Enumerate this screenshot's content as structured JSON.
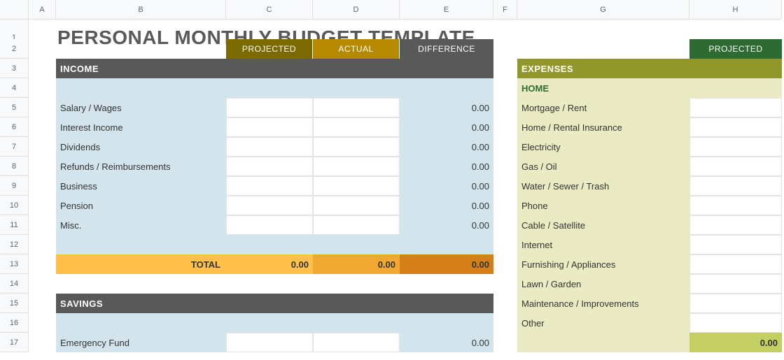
{
  "columns": [
    "A",
    "B",
    "C",
    "D",
    "E",
    "F",
    "G",
    "H"
  ],
  "rowNumbers": [
    "1",
    "2",
    "3",
    "4",
    "5",
    "6",
    "7",
    "8",
    "9",
    "10",
    "11",
    "12",
    "13",
    "14",
    "15",
    "16",
    "17"
  ],
  "title": "PERSONAL MONTHLY BUDGET TEMPLATE",
  "tabs": {
    "projected": "PROJECTED",
    "actual": "ACTUAL",
    "difference": "DIFFERENCE",
    "projected2": "PROJECTED"
  },
  "sections": {
    "income": "INCOME",
    "savings": "SAVINGS",
    "expenses": "EXPENSES",
    "home": "HOME"
  },
  "income": {
    "rows": [
      {
        "label": "Salary / Wages",
        "diff": "0.00"
      },
      {
        "label": "Interest Income",
        "diff": "0.00"
      },
      {
        "label": "Dividends",
        "diff": "0.00"
      },
      {
        "label": "Refunds / Reimbursements",
        "diff": "0.00"
      },
      {
        "label": "Business",
        "diff": "0.00"
      },
      {
        "label": "Pension",
        "diff": "0.00"
      },
      {
        "label": "Misc.",
        "diff": "0.00"
      }
    ],
    "totalLabel": "TOTAL",
    "totalProjected": "0.00",
    "totalActual": "0.00",
    "totalDiff": "0.00"
  },
  "savings": {
    "rows": [
      {
        "label": "Emergency Fund",
        "diff": "0.00"
      }
    ]
  },
  "expensesHome": {
    "rows": [
      "Mortgage / Rent",
      "Home / Rental Insurance",
      "Electricity",
      "Gas / Oil",
      "Water / Sewer / Trash",
      "Phone",
      "Cable / Satellite",
      "Internet",
      "Furnishing / Appliances",
      "Lawn / Garden",
      "Maintenance / Improvements",
      "Other"
    ],
    "total": "0.00"
  }
}
